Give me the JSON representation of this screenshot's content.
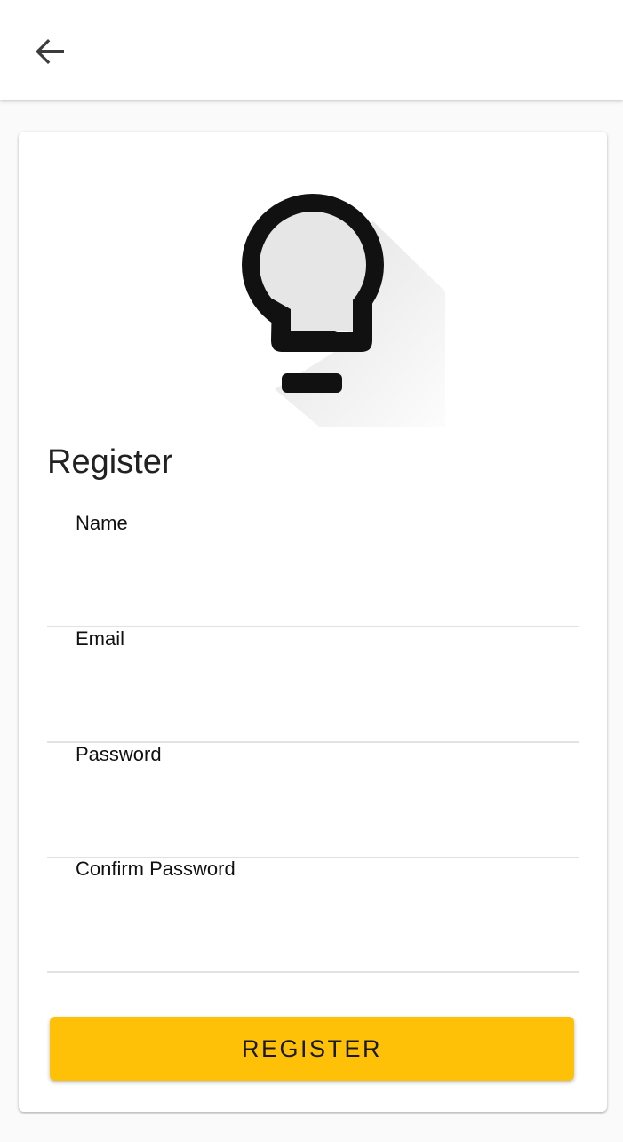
{
  "app_bar": {
    "back_icon": "arrow-back-icon"
  },
  "logo": {
    "icon": "lightbulb-icon",
    "color": "#000000"
  },
  "form": {
    "title": "Register",
    "fields": [
      {
        "label": "Name",
        "value": ""
      },
      {
        "label": "Email",
        "value": ""
      },
      {
        "label": "Password",
        "value": ""
      },
      {
        "label": "Confirm Password",
        "value": ""
      }
    ],
    "submit_label": "REGISTER"
  },
  "colors": {
    "accent": "#ffc107",
    "divider": "#e2e2e2",
    "text": "#212121"
  }
}
